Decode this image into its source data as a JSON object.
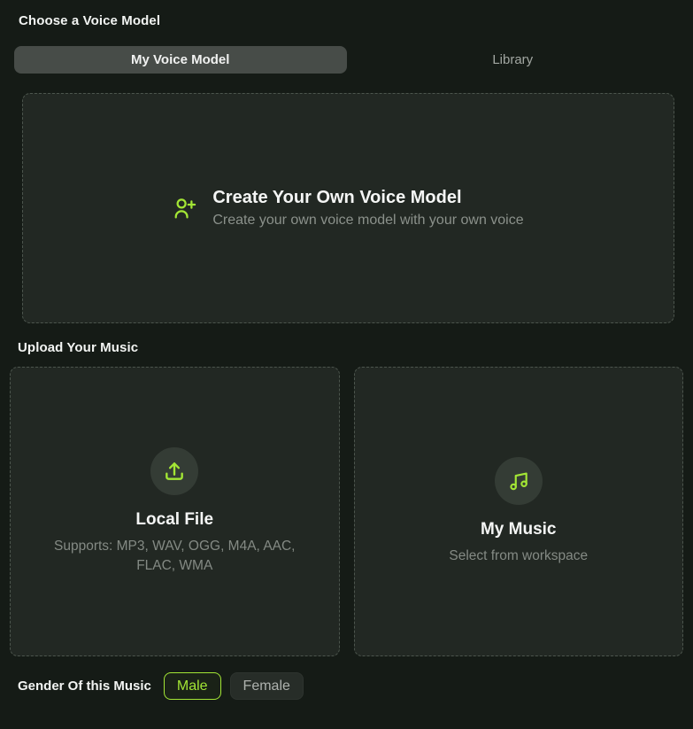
{
  "sections": {
    "choose_voice_label": "Choose a Voice Model",
    "upload_music_label": "Upload Your Music",
    "gender_label": "Gender Of this Music"
  },
  "tabs": [
    {
      "label": "My Voice Model",
      "selected": true
    },
    {
      "label": "Library",
      "selected": false
    }
  ],
  "create_voice": {
    "title": "Create Your Own Voice Model",
    "subtitle": "Create your own voice model with your own voice",
    "icon": "user-plus-icon"
  },
  "upload_options": [
    {
      "title": "Local File",
      "subtitle": "Supports: MP3, WAV, OGG, M4A, AAC, FLAC, WMA",
      "icon": "upload-icon"
    },
    {
      "title": "My Music",
      "subtitle": "Select from workspace",
      "icon": "music-note-icon"
    }
  ],
  "gender_options": [
    {
      "label": "Male",
      "selected": true
    },
    {
      "label": "Female",
      "selected": false
    }
  ],
  "colors": {
    "accent_green": "#a3e635",
    "page_bg": "#151b16",
    "panel_bg": "#222823",
    "dashed_border": "#4c554d",
    "tab_selected_bg": "#474c48",
    "icon_circle_bg": "#343c35"
  }
}
